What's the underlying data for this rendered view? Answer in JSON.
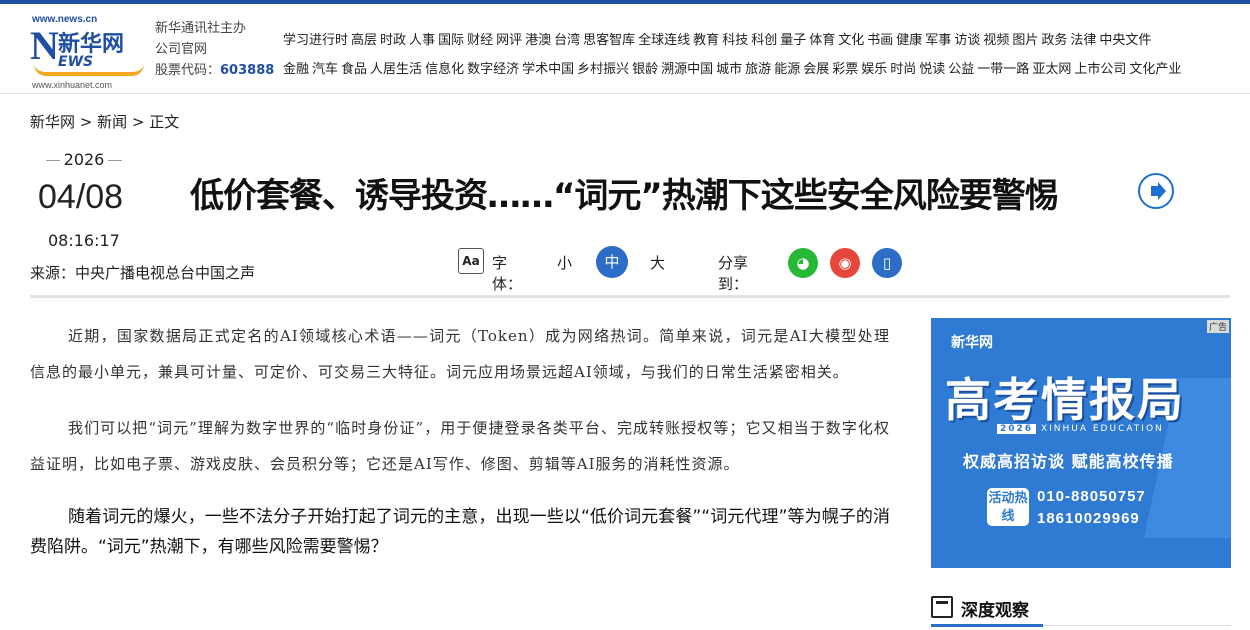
{
  "header": {
    "logo": {
      "url_top": "www.news.cn",
      "cn": "新华网",
      "en_n": "N",
      "en_ews": "EWS",
      "url_bottom": "www.xinhuanet.com"
    },
    "org": {
      "line1": "新华通讯社主办",
      "line2": "公司官网",
      "stock_label": "股票代码：",
      "stock_code": "603888"
    },
    "nav_row1": [
      "学习进行时",
      "高层",
      "时政",
      "人事",
      "国际",
      "财经",
      "网评",
      "港澳",
      "台湾",
      "思客智库",
      "全球连线",
      "教育",
      "科技",
      "科创",
      "量子",
      "体育",
      "文化",
      "书画",
      "健康",
      "军事",
      "访谈",
      "视频",
      "图片",
      "政务",
      "法律",
      "中央文件"
    ],
    "nav_row2": [
      "金融",
      "汽车",
      "食品",
      "人居生活",
      "信息化",
      "数字经济",
      "学术中国",
      "乡村振兴",
      "银龄",
      "溯源中国",
      "城市",
      "旅游",
      "能源",
      "会展",
      "彩票",
      "娱乐",
      "时尚",
      "悦读",
      "公益",
      "一带一路",
      "亚太网",
      "上市公司",
      "文化产业"
    ]
  },
  "breadcrumb": "新华网 > 新闻 > 正文",
  "date": {
    "year": "2026",
    "day": "04/08",
    "time": "08:16:17"
  },
  "source": "来源：中央广播电视总台中国之声",
  "title": "低价套餐、诱导投资……“词元”热潮下这些安全风险要警惕",
  "tools": {
    "aa": "Aa",
    "font_label": "字体：",
    "small": "小",
    "medium": "中",
    "large": "大",
    "share_label": "分享到：",
    "wechat_glyph": "◕",
    "weibo_glyph": "◉",
    "phone_glyph": "▯"
  },
  "article": {
    "p1": "近期，国家数据局正式定名的AI领域核心术语——词元（Token）成为网络热词。简单来说，词元是AI大模型处理信息的最小单元，兼具可计量、可定价、可交易三大特征。词元应用场景远超AI领域，与我们的日常生活紧密相关。",
    "p2": "我们可以把“词元”理解为数字世界的“临时身份证”，用于便捷登录各类平台、完成转账授权等；它又相当于数字化权益证明，比如电子票、游戏皮肤、会员积分等；它还是AI写作、修图、剪辑等AI服务的消耗性资源。",
    "p3": "随着词元的爆火，一些不法分子开始打起了词元的主意，出现一些以“低价词元套餐”“词元代理”等为幌子的消费陷阱。“词元”热潮下，有哪些风险需要警惕？"
  },
  "ad": {
    "tag": "广告",
    "logo": "新华网",
    "title": "高考情报局",
    "edu_year": "2026",
    "edu_text": "XINHUA EDUCATION",
    "sub": "权威高招访谈  赋能高校传播",
    "hot": "活动热线",
    "tel1": "010-88050757",
    "tel2": "18610029969"
  },
  "sidebar": {
    "section_title": "深度观察"
  },
  "colors": {
    "brand_blue": "#1f4fa3",
    "accent_blue": "#2d6cc7",
    "wechat": "#27b935",
    "weibo": "#e6473c"
  }
}
